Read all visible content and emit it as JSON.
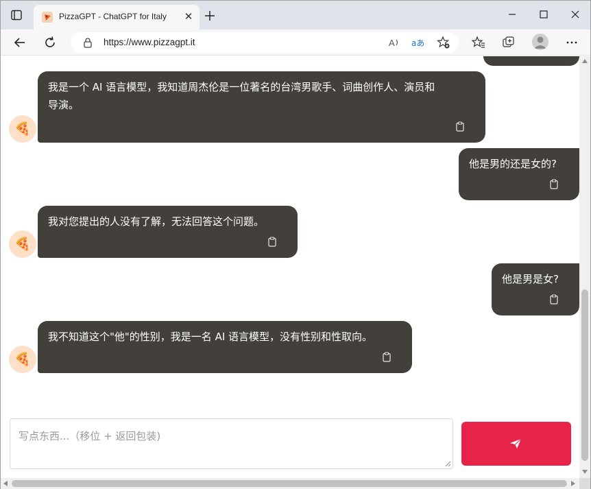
{
  "browser": {
    "tab_title": "PizzaGPT - ChatGPT for Italy",
    "url": "https://www.pizzagpt.it",
    "tab_close": "✕",
    "accent_color": "#e8234a"
  },
  "chat": {
    "messages": [
      {
        "role": "assistant",
        "lines": [
          "我是一个 AI 语言模型，我知道周杰伦是一位著名的台湾男歌手、词曲创作人、演员和",
          "导演。"
        ]
      },
      {
        "role": "user",
        "lines": [
          "他是男的还是女的?"
        ]
      },
      {
        "role": "assistant",
        "lines": [
          "我对您提出的人没有了解，无法回答这个问题。"
        ]
      },
      {
        "role": "user",
        "lines": [
          "他是男是女?"
        ]
      },
      {
        "role": "assistant",
        "lines": [
          "我不知道这个\"他\"的性别，我是一名 AI 语言模型，没有性别和性取向。"
        ]
      }
    ],
    "avatar_icon": "pizza-icon",
    "bubble_color": "#433f3a"
  },
  "composer": {
    "placeholder": "写点东西...（移位 + 返回包装)",
    "send_icon": "paper-plane-icon"
  }
}
